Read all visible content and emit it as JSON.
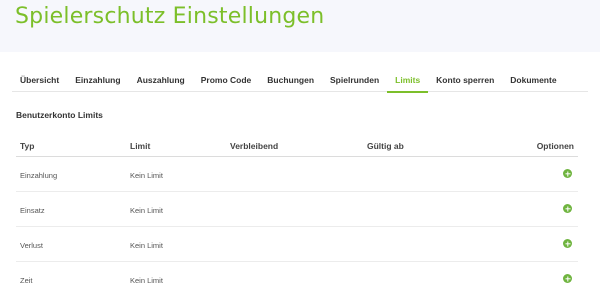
{
  "page": {
    "title": "Spielerschutz Einstellungen"
  },
  "tabs": [
    {
      "label": "Übersicht"
    },
    {
      "label": "Einzahlung"
    },
    {
      "label": "Auszahlung"
    },
    {
      "label": "Promo Code"
    },
    {
      "label": "Buchungen"
    },
    {
      "label": "Spielrunden"
    },
    {
      "label": "Limits",
      "active": true
    },
    {
      "label": "Konto sperren"
    },
    {
      "label": "Dokumente"
    }
  ],
  "section": {
    "title": "Benutzerkonto Limits"
  },
  "table": {
    "headers": {
      "type": "Typ",
      "limit": "Limit",
      "remaining": "Verbleibend",
      "valid_from": "Gültig ab",
      "options": "Optionen"
    },
    "rows": [
      {
        "type": "Einzahlung",
        "limit": "Kein Limit",
        "remaining": "",
        "valid_from": "",
        "action_icon": "plus-circle-icon"
      },
      {
        "type": "Einsatz",
        "limit": "Kein Limit",
        "remaining": "",
        "valid_from": "",
        "action_icon": "plus-circle-icon"
      },
      {
        "type": "Verlust",
        "limit": "Kein Limit",
        "remaining": "",
        "valid_from": "",
        "action_icon": "plus-circle-icon"
      },
      {
        "type": "Zeit",
        "limit": "Kein Limit",
        "remaining": "",
        "valid_from": "",
        "action_icon": "plus-circle-icon"
      }
    ]
  },
  "colors": {
    "accent": "#7cbf2a",
    "add_button": "#6fb43f",
    "header_bg": "#f6f7fc"
  }
}
